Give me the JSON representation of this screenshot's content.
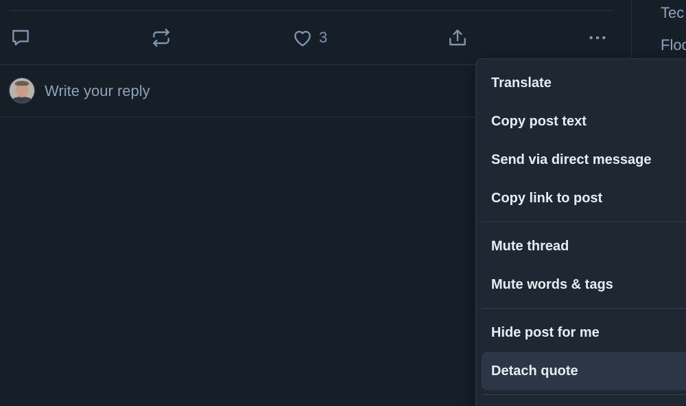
{
  "trending": [
    "Tec",
    "Floo"
  ],
  "actions": {
    "reply_icon": "comment-bubble-icon",
    "repost_icon": "repost-arrows-icon",
    "like_icon": "heart-icon",
    "like_count": "3",
    "share_icon": "share-upload-icon",
    "more_icon": "more-horizontal-icon"
  },
  "reply": {
    "placeholder": "Write your reply",
    "avatar": "user-avatar"
  },
  "menu": {
    "groups": [
      [
        "Translate",
        "Copy post text",
        "Send via direct message",
        "Copy link to post"
      ],
      [
        "Mute thread",
        "Mute words & tags"
      ],
      [
        "Hide post for me",
        "Detach quote"
      ]
    ],
    "highlighted": "Detach quote"
  },
  "colors": {
    "background": "#161e27",
    "menu_background": "#1e2833",
    "menu_highlight": "#2b3745",
    "icon": "#7f95ab",
    "menu_text": "#e8edf3"
  }
}
